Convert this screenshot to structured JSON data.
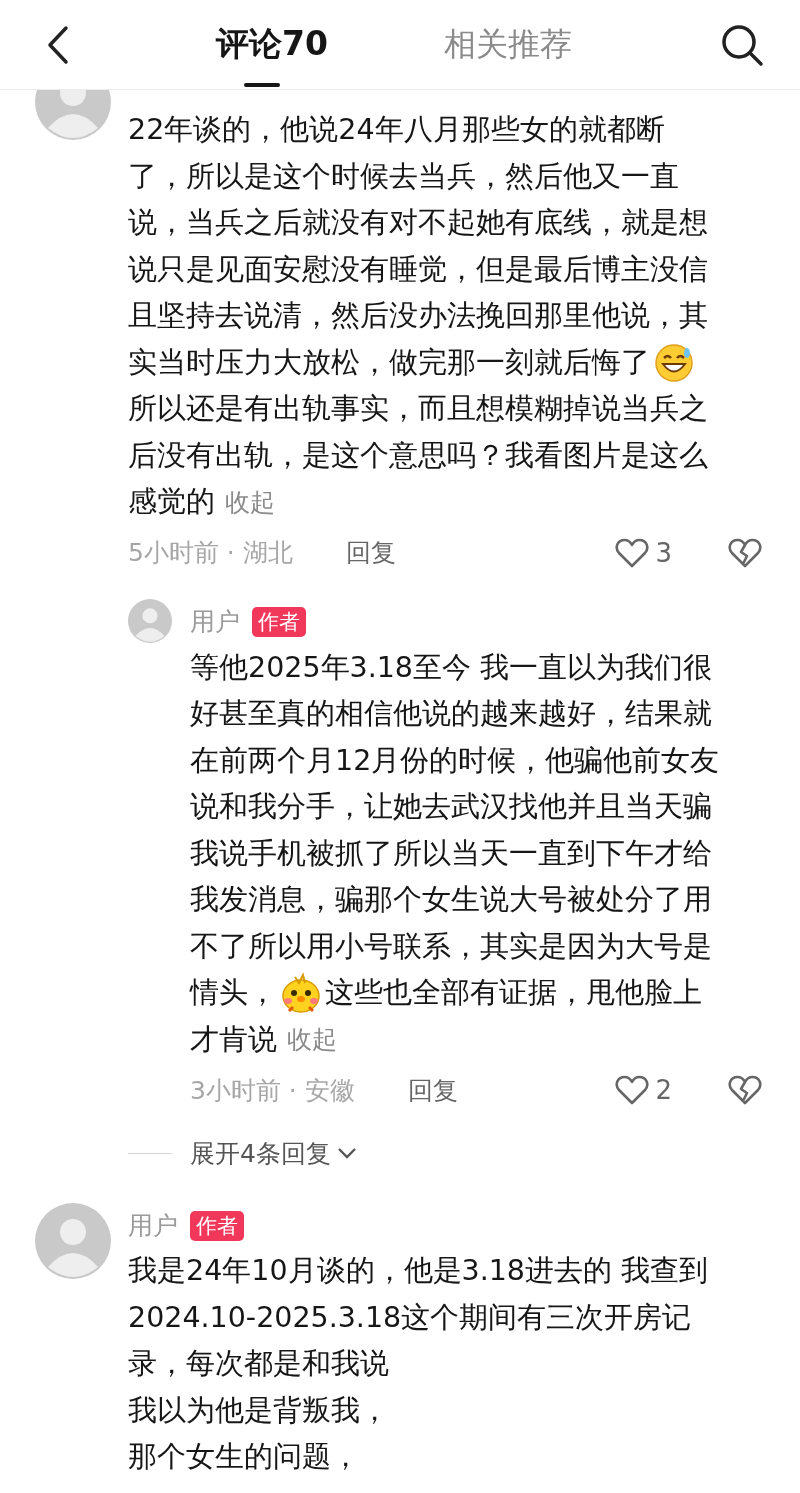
{
  "tabs": [
    {
      "label": "评论70",
      "selected": true
    },
    {
      "label": "相关推荐",
      "selected": false
    }
  ],
  "comments": [
    {
      "lines": [
        {
          "text": "22年谈的，他说24年八月那些女的就都断"
        },
        {
          "text": "了，所以是这个时候去当兵，然后他又一直"
        },
        {
          "text": "说，当兵之后就没有对不起她有底线，就是想"
        },
        {
          "text": "说只是见面安慰没有睡觉，但是最后博主没信"
        },
        {
          "text": "且坚持去说清，然后没办法挽回那里他说，其"
        },
        {
          "text": "实当时压力大放松，做完那一刻就后悔了",
          "kind": "grin"
        },
        {
          "text": "所以还是有出轨事实，而且想模糊掉说当兵之"
        },
        {
          "text": "后没有出轨，是这个意思吗？我看图片是这么"
        },
        {
          "text": "感觉的",
          "collapse": "收起"
        }
      ],
      "time": "5小时前 · 湖北",
      "reply": "回复",
      "likes": "3",
      "replies": [
        {
          "author": "用户",
          "badge": "作者",
          "lines": [
            {
              "text": "等他2025年3.18至今 我一直以为我们很"
            },
            {
              "text": "好甚至真的相信他说的越来越好，结果就"
            },
            {
              "text": "在前两个月12月份的时候，他骗他前女友"
            },
            {
              "text": "说和我分手，让她去武汉找他并且当天骗"
            },
            {
              "text": "我说手机被抓了所以当天一直到下午才给"
            },
            {
              "text": "我发消息，骗那个女生说大号被处分了用"
            },
            {
              "text": "不了所以用小号联系，其实是因为大号是"
            },
            {
              "text": "情头，",
              "kind": "chick",
              "after": "这些也全部有证据，甩他脸上"
            },
            {
              "text": "才肯说",
              "collapse": "收起"
            }
          ],
          "time": "3小时前 · 安徽",
          "reply": "回复",
          "likes": "2"
        }
      ],
      "expand": "展开4条回复"
    },
    {
      "author": "用户",
      "badge": "作者",
      "lines": [
        {
          "text": "我是24年10月谈的，他是3.18进去的 我查到"
        },
        {
          "text": "2024.10-2025.3.18这个期间有三次开房记"
        },
        {
          "text": "录，每次都是和我说"
        },
        {
          "text": "我以为他是背叛我，"
        },
        {
          "text": "那个女生的问题，"
        }
      ]
    }
  ]
}
